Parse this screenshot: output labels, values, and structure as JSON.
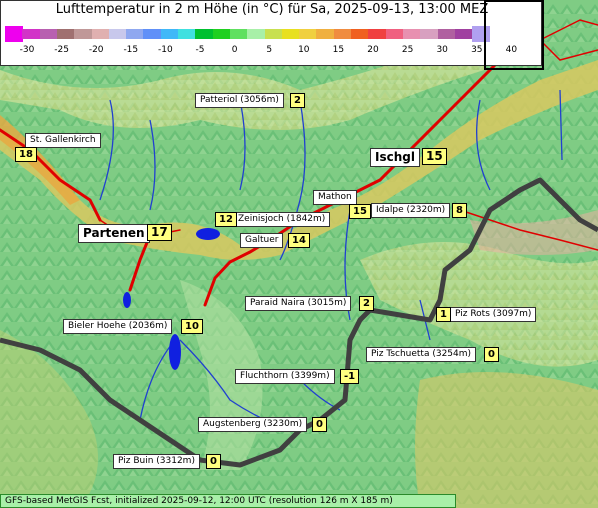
{
  "title": "Lufttemperatur in 2 m Höhe (in °C) für Sa, 2025-09-13, 13:00 MEZ",
  "scale": {
    "ticks": [
      "-30",
      "-25",
      "-20",
      "-15",
      "-10",
      "-5",
      "0",
      "5",
      "10",
      "15",
      "20",
      "25",
      "30",
      "35",
      "40"
    ],
    "colors": [
      "#ee00ee",
      "#d233c8",
      "#b860b0",
      "#a07070",
      "#c09898",
      "#e0b0b0",
      "#c8c8ec",
      "#8fa8f0",
      "#6090f8",
      "#40b8f8",
      "#40e0e0",
      "#00c030",
      "#20d020",
      "#60e060",
      "#a8f0a8",
      "#c8e050",
      "#e8e020",
      "#f0d040",
      "#f0b040",
      "#f08c40",
      "#f06020",
      "#f04040",
      "#f06080",
      "#e890b0",
      "#d8a0c0",
      "#b060a0",
      "#a040a0",
      "#b0a0f0"
    ]
  },
  "places": [
    {
      "name": "Patteriol (3056m)",
      "value": "2"
    },
    {
      "name": "St. Gallenkirch",
      "value": "18"
    },
    {
      "name": "Ischgl",
      "value": "15"
    },
    {
      "name": "Mathon",
      "value": "15"
    },
    {
      "name": "Idalpe (2320m)",
      "value": "8"
    },
    {
      "name": "Zeinisjoch (1842m)",
      "value": "12"
    },
    {
      "name": "Partenen",
      "value": "17"
    },
    {
      "name": "Galtuer",
      "value": "14"
    },
    {
      "name": "Paraid Naira (3015m)",
      "value": "2"
    },
    {
      "name": "Piz Rots (3097m)",
      "value": "1"
    },
    {
      "name": "Bieler Hoehe (2036m)",
      "value": "10"
    },
    {
      "name": "Piz Tschuetta (3254m)",
      "value": "0"
    },
    {
      "name": "Fluchthorn (3399m)",
      "value": "-1"
    },
    {
      "name": "Augstenberg (3230m)",
      "value": "0"
    },
    {
      "name": "Piz Buin (3312m)",
      "value": "0"
    }
  ],
  "footer": "GFS-based MetGIS Fcst, initialized 2025-09-12, 12:00 UTC  (resolution 126 m X 185 m)"
}
